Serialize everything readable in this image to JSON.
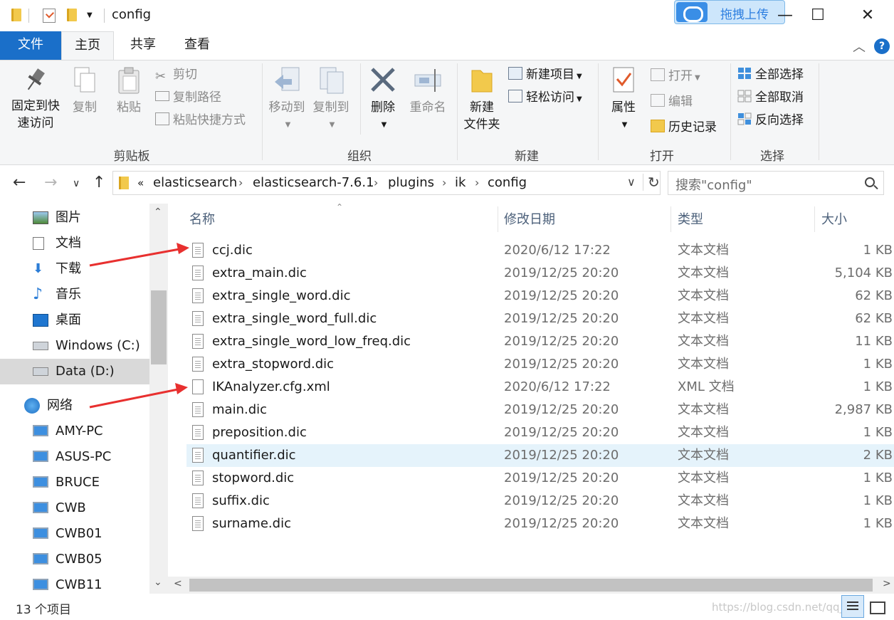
{
  "window": {
    "title": "config",
    "upload_label": "拖拽上传",
    "minimize": "—",
    "maximize": "☐",
    "close": "✕"
  },
  "tabs": [
    {
      "label": "文件"
    },
    {
      "label": "主页"
    },
    {
      "label": "共享"
    },
    {
      "label": "查看"
    }
  ],
  "ribbon": {
    "clipboard": {
      "label": "剪贴板",
      "pin_line1": "固定到快",
      "pin_line2": "速访问",
      "copy": "复制",
      "paste": "粘贴",
      "cut": "剪切",
      "copy_path": "复制路径",
      "paste_shortcut": "粘贴快捷方式"
    },
    "organize": {
      "label": "组织",
      "move_to": "移动到",
      "copy_to": "复制到",
      "delete": "删除",
      "rename": "重命名"
    },
    "new": {
      "label": "新建",
      "new_folder_line1": "新建",
      "new_folder_line2": "文件夹",
      "new_item": "新建项目",
      "easy_access": "轻松访问"
    },
    "open": {
      "label": "打开",
      "properties": "属性",
      "open": "打开",
      "edit": "编辑",
      "history": "历史记录"
    },
    "select": {
      "label": "选择",
      "select_all": "全部选择",
      "select_none": "全部取消",
      "invert": "反向选择"
    }
  },
  "address": {
    "overflow": "«",
    "crumbs": [
      "elasticsearch",
      "elasticsearch-7.6.1",
      "plugins",
      "ik",
      "config"
    ],
    "separator": "›",
    "dropdown": "∨",
    "refresh": "↻"
  },
  "search": {
    "placeholder": "搜索\"config\""
  },
  "nav": {
    "back": "←",
    "forward": "→",
    "recent": "∨",
    "up": "↑",
    "items": [
      {
        "label": "图片",
        "icon": "pictures-icon"
      },
      {
        "label": "文档",
        "icon": "documents-icon"
      },
      {
        "label": "下载",
        "icon": "downloads-icon"
      },
      {
        "label": "音乐",
        "icon": "music-icon"
      },
      {
        "label": "桌面",
        "icon": "desktop-icon"
      },
      {
        "label": "Windows (C:)",
        "icon": "drive-icon"
      },
      {
        "label": "Data (D:)",
        "icon": "drive-icon"
      },
      {
        "label": "网络",
        "icon": "network-icon"
      },
      {
        "label": "AMY-PC",
        "icon": "computer-icon"
      },
      {
        "label": "ASUS-PC",
        "icon": "computer-icon"
      },
      {
        "label": "BRUCE",
        "icon": "computer-icon"
      },
      {
        "label": "CWB",
        "icon": "computer-icon"
      },
      {
        "label": "CWB01",
        "icon": "computer-icon"
      },
      {
        "label": "CWB05",
        "icon": "computer-icon"
      },
      {
        "label": "CWB11",
        "icon": "computer-icon"
      }
    ],
    "scroll_up": "⌃",
    "scroll_down": "⌄"
  },
  "columns": {
    "name": "名称",
    "modified": "修改日期",
    "type": "类型",
    "size": "大小",
    "sort_arrow": "⌃"
  },
  "files": [
    {
      "name": "ccj.dic",
      "modified": "2020/6/12 17:22",
      "type": "文本文档",
      "size": "1 KB"
    },
    {
      "name": "extra_main.dic",
      "modified": "2019/12/25 20:20",
      "type": "文本文档",
      "size": "5,104 KB"
    },
    {
      "name": "extra_single_word.dic",
      "modified": "2019/12/25 20:20",
      "type": "文本文档",
      "size": "62 KB"
    },
    {
      "name": "extra_single_word_full.dic",
      "modified": "2019/12/25 20:20",
      "type": "文本文档",
      "size": "62 KB"
    },
    {
      "name": "extra_single_word_low_freq.dic",
      "modified": "2019/12/25 20:20",
      "type": "文本文档",
      "size": "11 KB"
    },
    {
      "name": "extra_stopword.dic",
      "modified": "2019/12/25 20:20",
      "type": "文本文档",
      "size": "1 KB"
    },
    {
      "name": "IKAnalyzer.cfg.xml",
      "modified": "2020/6/12 17:22",
      "type": "XML 文档",
      "size": "1 KB"
    },
    {
      "name": "main.dic",
      "modified": "2019/12/25 20:20",
      "type": "文本文档",
      "size": "2,987 KB"
    },
    {
      "name": "preposition.dic",
      "modified": "2019/12/25 20:20",
      "type": "文本文档",
      "size": "1 KB"
    },
    {
      "name": "quantifier.dic",
      "modified": "2019/12/25 20:20",
      "type": "文本文档",
      "size": "2 KB"
    },
    {
      "name": "stopword.dic",
      "modified": "2019/12/25 20:20",
      "type": "文本文档",
      "size": "1 KB"
    },
    {
      "name": "suffix.dic",
      "modified": "2019/12/25 20:20",
      "type": "文本文档",
      "size": "1 KB"
    },
    {
      "name": "surname.dic",
      "modified": "2019/12/25 20:20",
      "type": "文本文档",
      "size": "1 KB"
    }
  ],
  "hscroll": {
    "left": "<",
    "right": ">"
  },
  "status": {
    "count": "13 个项目",
    "watermark": "https://blog.csdn.net/qq_4..."
  },
  "colors": {
    "accent": "#1a6fc9",
    "selected_row": "#e5f3fb",
    "annotation_arrow": "#e8302f"
  }
}
